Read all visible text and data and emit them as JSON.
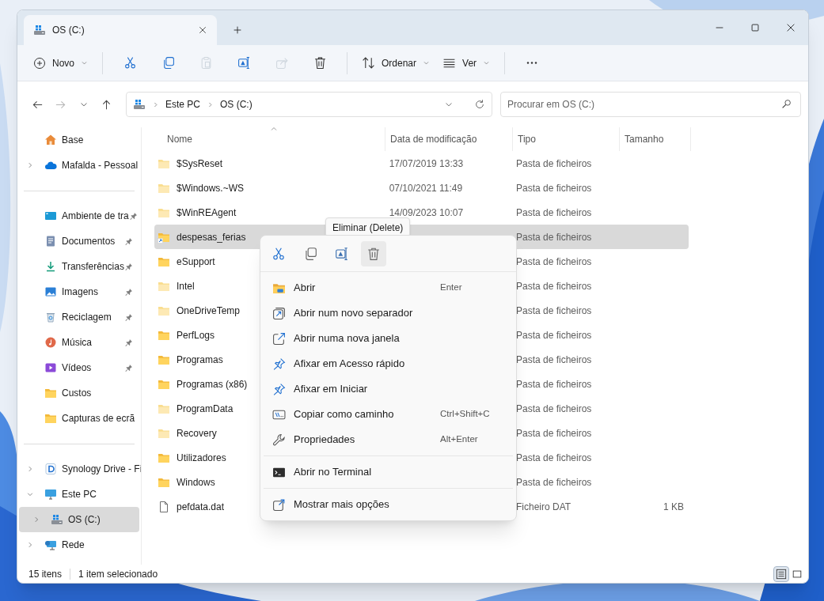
{
  "window": {
    "tabs": [
      {
        "label": "OS (C:)",
        "kind": "drive",
        "selected": true
      }
    ]
  },
  "toolbar": {
    "items": [
      {
        "kind": "new",
        "label": "Novo",
        "disabled": false
      },
      {
        "kind": "separator"
      },
      {
        "kind": "cut",
        "disabled": false
      },
      {
        "kind": "copy",
        "disabled": false
      },
      {
        "kind": "paste",
        "disabled": true
      },
      {
        "kind": "rename",
        "disabled": false
      },
      {
        "kind": "share",
        "disabled": true
      },
      {
        "kind": "delete",
        "disabled": false
      },
      {
        "kind": "separator"
      },
      {
        "kind": "sort",
        "label": "Ordenar",
        "disabled": false
      },
      {
        "kind": "view",
        "label": "Ver",
        "disabled": false
      },
      {
        "kind": "separator"
      },
      {
        "kind": "more",
        "disabled": false
      }
    ]
  },
  "navigation": [
    {
      "kind": "back",
      "disabled": false
    },
    {
      "kind": "forward",
      "disabled": true
    },
    {
      "kind": "recent",
      "disabled": false
    },
    {
      "kind": "up",
      "disabled": false
    }
  ],
  "address": {
    "kind": "drive",
    "crumbs": [
      "Este PC",
      "OS (C:)"
    ]
  },
  "search": {
    "placeholder": "Procurar em OS (C:)"
  },
  "sidebar": {
    "sections": [
      {
        "items": [
          {
            "label": "Base",
            "kind": "home",
            "pinned": false,
            "selected": false
          },
          {
            "label": "Mafalda - Pessoal",
            "kind": "cloud",
            "expanded": false,
            "pinned": false,
            "selected": false
          }
        ]
      },
      {
        "items": [
          {
            "label": "Ambiente de tra",
            "kind": "desktop",
            "pinned": true,
            "selected": false
          },
          {
            "label": "Documentos",
            "kind": "docs",
            "pinned": true,
            "selected": false
          },
          {
            "label": "Transferências",
            "kind": "download",
            "pinned": true,
            "selected": false
          },
          {
            "label": "Imagens",
            "kind": "pictures",
            "pinned": true,
            "selected": false
          },
          {
            "label": "Reciclagem",
            "kind": "recycle",
            "pinned": true,
            "selected": false
          },
          {
            "label": "Música",
            "kind": "music",
            "pinned": true,
            "selected": false
          },
          {
            "label": "Vídeos",
            "kind": "videos",
            "pinned": true,
            "selected": false
          },
          {
            "label": "Custos",
            "kind": "folder",
            "pinned": false,
            "selected": false
          },
          {
            "label": "Capturas de ecrã",
            "kind": "folder",
            "pinned": false,
            "selected": false
          }
        ]
      },
      {
        "items": [
          {
            "label": "Synology Drive - Fi",
            "kind": "synology",
            "expanded": false,
            "pinned": false,
            "selected": false
          },
          {
            "label": "Este PC",
            "kind": "pc",
            "expanded": true,
            "pinned": false,
            "selected": false,
            "children": [
              {
                "label": "OS (C:)",
                "kind": "drive",
                "expanded": false,
                "pinned": false,
                "selected": true
              }
            ]
          },
          {
            "label": "Rede",
            "kind": "network",
            "expanded": false,
            "pinned": false,
            "selected": false
          }
        ]
      }
    ]
  },
  "table": {
    "columns": [
      {
        "label": "Nome",
        "sorted": true
      },
      {
        "label": "Data de modificação",
        "sorted": false
      },
      {
        "label": "Tipo",
        "sorted": false
      },
      {
        "label": "Tamanho",
        "sorted": false
      }
    ],
    "rows": [
      {
        "name": "$SysReset",
        "kind": "folder",
        "hidden": true,
        "date": "17/07/2019 13:33",
        "type": "Pasta de ficheiros",
        "selected": false
      },
      {
        "name": "$Windows.~WS",
        "kind": "folder",
        "hidden": true,
        "date": "07/10/2021 11:49",
        "type": "Pasta de ficheiros",
        "selected": false
      },
      {
        "name": "$WinREAgent",
        "kind": "folder",
        "hidden": true,
        "date": "14/09/2023 10:07",
        "type": "Pasta de ficheiros",
        "selected": false
      },
      {
        "name": "despesas_ferias",
        "kind": "shortcut_folder",
        "hidden": false,
        "type": "Pasta de ficheiros",
        "selected": true
      },
      {
        "name": "eSupport",
        "kind": "folder",
        "hidden": false,
        "type": "Pasta de ficheiros",
        "selected": false
      },
      {
        "name": "Intel",
        "kind": "folder",
        "hidden": true,
        "type": "Pasta de ficheiros",
        "selected": false
      },
      {
        "name": "OneDriveTemp",
        "kind": "folder",
        "hidden": true,
        "type": "Pasta de ficheiros",
        "selected": false
      },
      {
        "name": "PerfLogs",
        "kind": "folder",
        "hidden": false,
        "type": "Pasta de ficheiros",
        "selected": false
      },
      {
        "name": "Programas",
        "kind": "folder",
        "hidden": false,
        "type": "Pasta de ficheiros",
        "selected": false
      },
      {
        "name": "Programas (x86)",
        "kind": "folder",
        "hidden": false,
        "type": "Pasta de ficheiros",
        "selected": false
      },
      {
        "name": "ProgramData",
        "kind": "folder",
        "hidden": true,
        "type": "Pasta de ficheiros",
        "selected": false
      },
      {
        "name": "Recovery",
        "kind": "folder",
        "hidden": true,
        "type": "Pasta de ficheiros",
        "selected": false
      },
      {
        "name": "Utilizadores",
        "kind": "folder",
        "hidden": false,
        "type": "Pasta de ficheiros",
        "selected": false
      },
      {
        "name": "Windows",
        "kind": "folder",
        "hidden": false,
        "type": "Pasta de ficheiros",
        "selected": false
      },
      {
        "name": "pefdata.dat",
        "kind": "file",
        "type": "Ficheiro DAT",
        "size": "1 KB",
        "selected": false
      }
    ]
  },
  "context_menu": {
    "tooltip": "Eliminar (Delete)",
    "quick_actions": [
      {
        "kind": "cut",
        "hovered": false
      },
      {
        "kind": "copy",
        "hovered": false
      },
      {
        "kind": "rename",
        "hovered": false
      },
      {
        "kind": "delete",
        "hovered": true
      }
    ],
    "sections": [
      {
        "items": [
          {
            "kind": "open",
            "label": "Abrir",
            "shortcut": "Enter"
          },
          {
            "kind": "new_tab",
            "label": "Abrir num novo separador"
          },
          {
            "kind": "new_window",
            "label": "Abrir numa nova janela"
          },
          {
            "kind": "pin",
            "label": "Afixar em Acesso rápido"
          },
          {
            "kind": "pin",
            "label": "Afixar em Iniciar"
          },
          {
            "kind": "copy_path",
            "label": "Copiar como caminho",
            "shortcut": "Ctrl+Shift+C"
          },
          {
            "kind": "properties",
            "label": "Propriedades",
            "shortcut": "Alt+Enter"
          }
        ]
      },
      {
        "items": [
          {
            "kind": "terminal",
            "label": "Abrir no Terminal"
          }
        ]
      },
      {
        "items": [
          {
            "kind": "more_options",
            "label": "Mostrar mais opções"
          }
        ]
      }
    ]
  },
  "status_bar": {
    "count": "15 itens",
    "selection": "1 item selecionado",
    "views": [
      {
        "kind": "details",
        "selected": true
      },
      {
        "kind": "tiles",
        "selected": false
      }
    ]
  }
}
